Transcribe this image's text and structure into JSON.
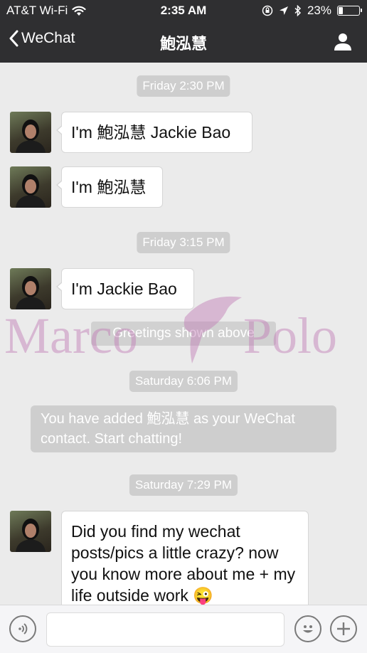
{
  "status_bar": {
    "carrier": "AT&T Wi-Fi",
    "time": "2:35 AM",
    "battery_percent": "23%",
    "battery_level": 0.23
  },
  "nav": {
    "back_label": "WeChat",
    "title": "鮑泓慧"
  },
  "messages": [
    {
      "type": "time",
      "text": "Friday 2:30 PM"
    },
    {
      "type": "received",
      "text": "I'm 鮑泓慧 Jackie Bao"
    },
    {
      "type": "received",
      "text": "I'm 鮑泓慧"
    },
    {
      "type": "time",
      "text": "Friday 3:15 PM"
    },
    {
      "type": "received",
      "text": "I'm Jackie Bao"
    },
    {
      "type": "system",
      "text": "Greetings shown above"
    },
    {
      "type": "time",
      "text": "Saturday 6:06 PM"
    },
    {
      "type": "system",
      "text": "You have added 鮑泓慧 as your WeChat contact. Start chatting!"
    },
    {
      "type": "time",
      "text": "Saturday 7:29 PM"
    },
    {
      "type": "received",
      "text": "Did you find my wechat posts/pics a little crazy? now you know more about me + my life outside work 😜"
    }
  ],
  "watermark": {
    "left_word": "Marco",
    "right_word": "Polo"
  },
  "input": {
    "placeholder": ""
  },
  "colors": {
    "header_bg": "#2f2f31",
    "chat_bg": "#ebebeb",
    "time_label_bg": "#cecece",
    "bubble_bg": "#ffffff",
    "watermark": "#be78b4"
  }
}
